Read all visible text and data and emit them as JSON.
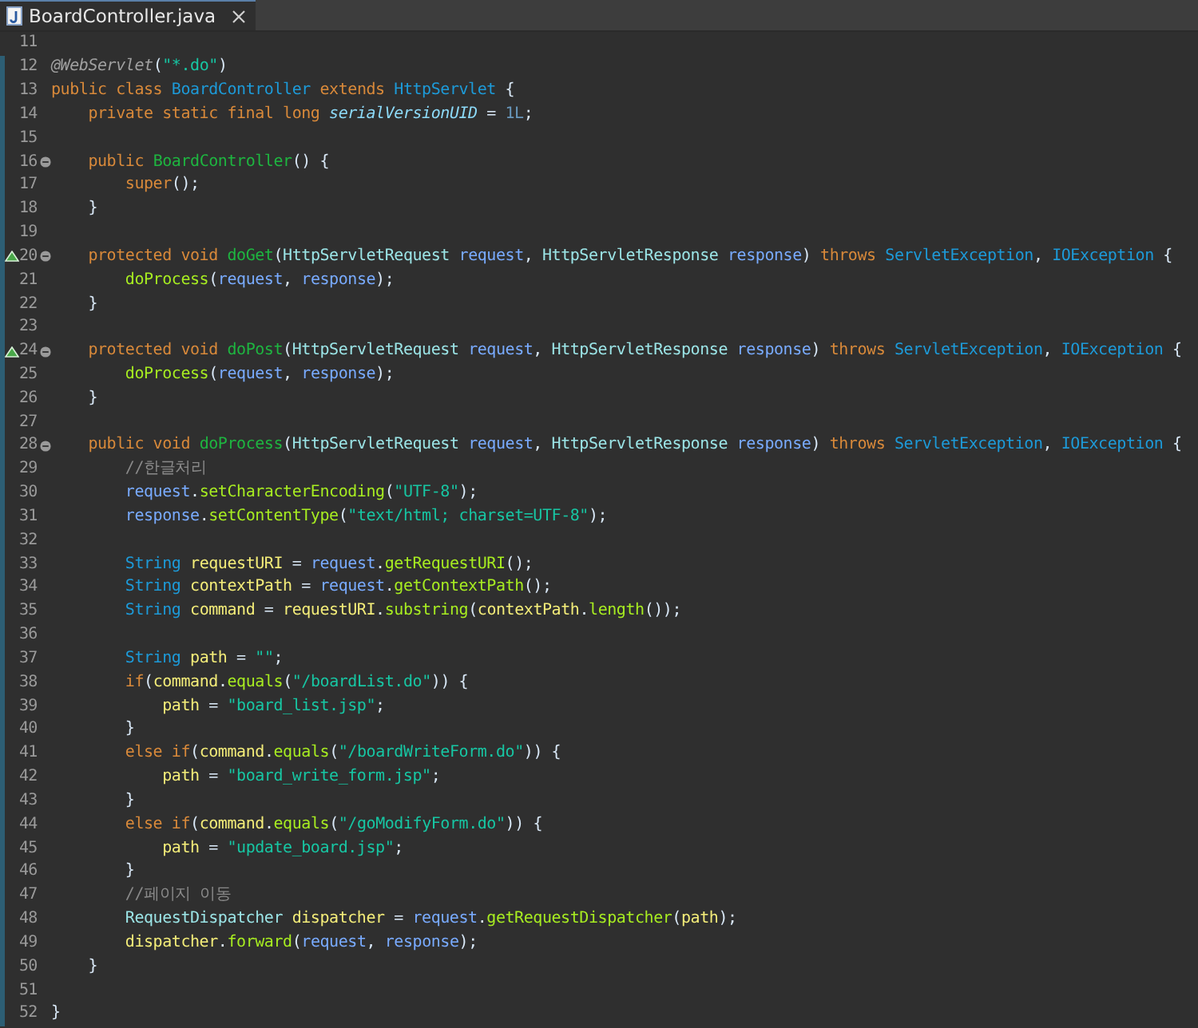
{
  "tabs": [
    {
      "label": "BoardController.java",
      "selected": true
    }
  ],
  "editor": {
    "lines": [
      {
        "number": "11",
        "changed": false,
        "fold": false,
        "override": false
      },
      {
        "number": "12",
        "changed": true,
        "fold": false,
        "override": false,
        "tokens": [
          {
            "kind": "ann",
            "text": "@WebServlet"
          },
          {
            "kind": "plain",
            "text": "("
          },
          {
            "kind": "str",
            "text": "\"*.do\""
          },
          {
            "kind": "plain",
            "text": ")"
          }
        ]
      },
      {
        "number": "13",
        "changed": true,
        "fold": false,
        "override": false,
        "tokens": [
          {
            "kind": "kw",
            "text": "public class "
          },
          {
            "kind": "cls",
            "text": "BoardController"
          },
          {
            "kind": "kw",
            "text": " extends "
          },
          {
            "kind": "cls",
            "text": "HttpServlet"
          },
          {
            "kind": "plain",
            "text": " {"
          }
        ]
      },
      {
        "number": "14",
        "changed": true,
        "fold": false,
        "override": false,
        "tokens": [
          {
            "kind": "kw",
            "text": "    private static final long "
          },
          {
            "kind": "field",
            "text": "serialVersionUID"
          },
          {
            "kind": "plain",
            "text": " = "
          },
          {
            "kind": "num",
            "text": "1L"
          },
          {
            "kind": "plain",
            "text": ";"
          }
        ]
      },
      {
        "number": "15",
        "changed": true,
        "fold": false,
        "override": false
      },
      {
        "number": "16",
        "changed": true,
        "fold": true,
        "override": false,
        "tokens": [
          {
            "kind": "kw",
            "text": "    public "
          },
          {
            "kind": "decl",
            "text": "BoardController"
          },
          {
            "kind": "plain",
            "text": "() {"
          }
        ]
      },
      {
        "number": "17",
        "changed": true,
        "fold": false,
        "override": false,
        "tokens": [
          {
            "kind": "kw",
            "text": "        super"
          },
          {
            "kind": "plain",
            "text": "();"
          }
        ]
      },
      {
        "number": "18",
        "changed": true,
        "fold": false,
        "override": false,
        "tokens": [
          {
            "kind": "plain",
            "text": "    }"
          }
        ]
      },
      {
        "number": "19",
        "changed": true,
        "fold": false,
        "override": false
      },
      {
        "number": "20",
        "changed": true,
        "fold": true,
        "override": true,
        "tokens": [
          {
            "kind": "kw",
            "text": "    protected void "
          },
          {
            "kind": "decl",
            "text": "doGet"
          },
          {
            "kind": "plain",
            "text": "("
          },
          {
            "kind": "typ",
            "text": "HttpServletRequest"
          },
          {
            "kind": "param",
            "text": " request"
          },
          {
            "kind": "plain",
            "text": ", "
          },
          {
            "kind": "typ",
            "text": "HttpServletResponse"
          },
          {
            "kind": "param",
            "text": " response"
          },
          {
            "kind": "plain",
            "text": ") "
          },
          {
            "kind": "kw",
            "text": "throws "
          },
          {
            "kind": "cls",
            "text": "ServletException"
          },
          {
            "kind": "plain",
            "text": ", "
          },
          {
            "kind": "cls",
            "text": "IOException"
          },
          {
            "kind": "plain",
            "text": " {"
          }
        ]
      },
      {
        "number": "21",
        "changed": true,
        "fold": false,
        "override": false,
        "tokens": [
          {
            "kind": "call",
            "text": "        doProcess"
          },
          {
            "kind": "plain",
            "text": "("
          },
          {
            "kind": "param",
            "text": "request"
          },
          {
            "kind": "plain",
            "text": ", "
          },
          {
            "kind": "param",
            "text": "response"
          },
          {
            "kind": "plain",
            "text": ");"
          }
        ]
      },
      {
        "number": "22",
        "changed": true,
        "fold": false,
        "override": false,
        "tokens": [
          {
            "kind": "plain",
            "text": "    }"
          }
        ]
      },
      {
        "number": "23",
        "changed": true,
        "fold": false,
        "override": false
      },
      {
        "number": "24",
        "changed": true,
        "fold": true,
        "override": true,
        "tokens": [
          {
            "kind": "kw",
            "text": "    protected void "
          },
          {
            "kind": "decl",
            "text": "doPost"
          },
          {
            "kind": "plain",
            "text": "("
          },
          {
            "kind": "typ",
            "text": "HttpServletRequest"
          },
          {
            "kind": "param",
            "text": " request"
          },
          {
            "kind": "plain",
            "text": ", "
          },
          {
            "kind": "typ",
            "text": "HttpServletResponse"
          },
          {
            "kind": "param",
            "text": " response"
          },
          {
            "kind": "plain",
            "text": ") "
          },
          {
            "kind": "kw",
            "text": "throws "
          },
          {
            "kind": "cls",
            "text": "ServletException"
          },
          {
            "kind": "plain",
            "text": ", "
          },
          {
            "kind": "cls",
            "text": "IOException"
          },
          {
            "kind": "plain",
            "text": " {"
          }
        ]
      },
      {
        "number": "25",
        "changed": true,
        "fold": false,
        "override": false,
        "tokens": [
          {
            "kind": "call",
            "text": "        doProcess"
          },
          {
            "kind": "plain",
            "text": "("
          },
          {
            "kind": "param",
            "text": "request"
          },
          {
            "kind": "plain",
            "text": ", "
          },
          {
            "kind": "param",
            "text": "response"
          },
          {
            "kind": "plain",
            "text": ");"
          }
        ]
      },
      {
        "number": "26",
        "changed": true,
        "fold": false,
        "override": false,
        "tokens": [
          {
            "kind": "plain",
            "text": "    }"
          }
        ]
      },
      {
        "number": "27",
        "changed": true,
        "fold": false,
        "override": false
      },
      {
        "number": "28",
        "changed": true,
        "fold": true,
        "override": false,
        "tokens": [
          {
            "kind": "kw",
            "text": "    public void "
          },
          {
            "kind": "decl",
            "text": "doProcess"
          },
          {
            "kind": "plain",
            "text": "("
          },
          {
            "kind": "typ",
            "text": "HttpServletRequest"
          },
          {
            "kind": "param",
            "text": " request"
          },
          {
            "kind": "plain",
            "text": ", "
          },
          {
            "kind": "typ",
            "text": "HttpServletResponse"
          },
          {
            "kind": "param",
            "text": " response"
          },
          {
            "kind": "plain",
            "text": ") "
          },
          {
            "kind": "kw",
            "text": "throws "
          },
          {
            "kind": "cls",
            "text": "ServletException"
          },
          {
            "kind": "plain",
            "text": ", "
          },
          {
            "kind": "cls",
            "text": "IOException"
          },
          {
            "kind": "plain",
            "text": " {"
          }
        ]
      },
      {
        "number": "29",
        "changed": true,
        "fold": false,
        "override": false,
        "tokens": [
          {
            "kind": "cmt",
            "text": "        //한글처리"
          }
        ]
      },
      {
        "number": "30",
        "changed": true,
        "fold": false,
        "override": false,
        "tokens": [
          {
            "kind": "param",
            "text": "        request"
          },
          {
            "kind": "plain",
            "text": "."
          },
          {
            "kind": "call",
            "text": "setCharacterEncoding"
          },
          {
            "kind": "plain",
            "text": "("
          },
          {
            "kind": "str",
            "text": "\"UTF-8\""
          },
          {
            "kind": "plain",
            "text": ");"
          }
        ]
      },
      {
        "number": "31",
        "changed": true,
        "fold": false,
        "override": false,
        "tokens": [
          {
            "kind": "param",
            "text": "        response"
          },
          {
            "kind": "plain",
            "text": "."
          },
          {
            "kind": "call",
            "text": "setContentType"
          },
          {
            "kind": "plain",
            "text": "("
          },
          {
            "kind": "str",
            "text": "\"text/html; charset=UTF-8\""
          },
          {
            "kind": "plain",
            "text": ");"
          }
        ]
      },
      {
        "number": "32",
        "changed": true,
        "fold": false,
        "override": false
      },
      {
        "number": "33",
        "changed": true,
        "fold": false,
        "override": false,
        "tokens": [
          {
            "kind": "cls",
            "text": "        String"
          },
          {
            "kind": "local",
            "text": " requestURI"
          },
          {
            "kind": "plain",
            "text": " = "
          },
          {
            "kind": "param",
            "text": "request"
          },
          {
            "kind": "plain",
            "text": "."
          },
          {
            "kind": "call",
            "text": "getRequestURI"
          },
          {
            "kind": "plain",
            "text": "();"
          }
        ]
      },
      {
        "number": "34",
        "changed": true,
        "fold": false,
        "override": false,
        "tokens": [
          {
            "kind": "cls",
            "text": "        String"
          },
          {
            "kind": "local",
            "text": " contextPath"
          },
          {
            "kind": "plain",
            "text": " = "
          },
          {
            "kind": "param",
            "text": "request"
          },
          {
            "kind": "plain",
            "text": "."
          },
          {
            "kind": "call",
            "text": "getContextPath"
          },
          {
            "kind": "plain",
            "text": "();"
          }
        ]
      },
      {
        "number": "35",
        "changed": true,
        "fold": false,
        "override": false,
        "tokens": [
          {
            "kind": "cls",
            "text": "        String"
          },
          {
            "kind": "local",
            "text": " command"
          },
          {
            "kind": "plain",
            "text": " = "
          },
          {
            "kind": "local",
            "text": "requestURI"
          },
          {
            "kind": "plain",
            "text": "."
          },
          {
            "kind": "call",
            "text": "substring"
          },
          {
            "kind": "plain",
            "text": "("
          },
          {
            "kind": "local",
            "text": "contextPath"
          },
          {
            "kind": "plain",
            "text": "."
          },
          {
            "kind": "call",
            "text": "length"
          },
          {
            "kind": "plain",
            "text": "());"
          }
        ]
      },
      {
        "number": "36",
        "changed": true,
        "fold": false,
        "override": false
      },
      {
        "number": "37",
        "changed": true,
        "fold": false,
        "override": false,
        "tokens": [
          {
            "kind": "cls",
            "text": "        String"
          },
          {
            "kind": "local",
            "text": " path"
          },
          {
            "kind": "plain",
            "text": " = "
          },
          {
            "kind": "str",
            "text": "\"\""
          },
          {
            "kind": "plain",
            "text": ";"
          }
        ]
      },
      {
        "number": "38",
        "changed": true,
        "fold": false,
        "override": false,
        "tokens": [
          {
            "kind": "kw",
            "text": "        if"
          },
          {
            "kind": "plain",
            "text": "("
          },
          {
            "kind": "local",
            "text": "command"
          },
          {
            "kind": "plain",
            "text": "."
          },
          {
            "kind": "call",
            "text": "equals"
          },
          {
            "kind": "plain",
            "text": "("
          },
          {
            "kind": "str",
            "text": "\"/boardList.do\""
          },
          {
            "kind": "plain",
            "text": ")) {"
          }
        ]
      },
      {
        "number": "39",
        "changed": true,
        "fold": false,
        "override": false,
        "tokens": [
          {
            "kind": "local",
            "text": "            path"
          },
          {
            "kind": "plain",
            "text": " = "
          },
          {
            "kind": "str",
            "text": "\"board_list.jsp\""
          },
          {
            "kind": "plain",
            "text": ";"
          }
        ]
      },
      {
        "number": "40",
        "changed": true,
        "fold": false,
        "override": false,
        "tokens": [
          {
            "kind": "plain",
            "text": "        }"
          }
        ]
      },
      {
        "number": "41",
        "changed": true,
        "fold": false,
        "override": false,
        "tokens": [
          {
            "kind": "kw",
            "text": "        else if"
          },
          {
            "kind": "plain",
            "text": "("
          },
          {
            "kind": "local",
            "text": "command"
          },
          {
            "kind": "plain",
            "text": "."
          },
          {
            "kind": "call",
            "text": "equals"
          },
          {
            "kind": "plain",
            "text": "("
          },
          {
            "kind": "str",
            "text": "\"/boardWriteForm.do\""
          },
          {
            "kind": "plain",
            "text": ")) {"
          }
        ]
      },
      {
        "number": "42",
        "changed": true,
        "fold": false,
        "override": false,
        "tokens": [
          {
            "kind": "local",
            "text": "            path"
          },
          {
            "kind": "plain",
            "text": " = "
          },
          {
            "kind": "str",
            "text": "\"board_write_form.jsp\""
          },
          {
            "kind": "plain",
            "text": ";"
          }
        ]
      },
      {
        "number": "43",
        "changed": true,
        "fold": false,
        "override": false,
        "tokens": [
          {
            "kind": "plain",
            "text": "        }"
          }
        ]
      },
      {
        "number": "44",
        "changed": true,
        "fold": false,
        "override": false,
        "tokens": [
          {
            "kind": "kw",
            "text": "        else if"
          },
          {
            "kind": "plain",
            "text": "("
          },
          {
            "kind": "local",
            "text": "command"
          },
          {
            "kind": "plain",
            "text": "."
          },
          {
            "kind": "call",
            "text": "equals"
          },
          {
            "kind": "plain",
            "text": "("
          },
          {
            "kind": "str",
            "text": "\"/goModifyForm.do\""
          },
          {
            "kind": "plain",
            "text": ")) {"
          }
        ]
      },
      {
        "number": "45",
        "changed": true,
        "fold": false,
        "override": false,
        "tokens": [
          {
            "kind": "local",
            "text": "            path"
          },
          {
            "kind": "plain",
            "text": " = "
          },
          {
            "kind": "str",
            "text": "\"update_board.jsp\""
          },
          {
            "kind": "plain",
            "text": ";"
          }
        ]
      },
      {
        "number": "46",
        "changed": true,
        "fold": false,
        "override": false,
        "tokens": [
          {
            "kind": "plain",
            "text": "        }"
          }
        ]
      },
      {
        "number": "47",
        "changed": true,
        "fold": false,
        "override": false,
        "tokens": [
          {
            "kind": "cmt",
            "text": "        //페이지 이동"
          }
        ]
      },
      {
        "number": "48",
        "changed": true,
        "fold": false,
        "override": false,
        "tokens": [
          {
            "kind": "typ",
            "text": "        RequestDispatcher"
          },
          {
            "kind": "local",
            "text": " dispatcher"
          },
          {
            "kind": "plain",
            "text": " = "
          },
          {
            "kind": "param",
            "text": "request"
          },
          {
            "kind": "plain",
            "text": "."
          },
          {
            "kind": "call",
            "text": "getRequestDispatcher"
          },
          {
            "kind": "plain",
            "text": "("
          },
          {
            "kind": "local",
            "text": "path"
          },
          {
            "kind": "plain",
            "text": ");"
          }
        ]
      },
      {
        "number": "49",
        "changed": true,
        "fold": false,
        "override": false,
        "tokens": [
          {
            "kind": "local",
            "text": "        dispatcher"
          },
          {
            "kind": "plain",
            "text": "."
          },
          {
            "kind": "call",
            "text": "forward"
          },
          {
            "kind": "plain",
            "text": "("
          },
          {
            "kind": "param",
            "text": "request"
          },
          {
            "kind": "plain",
            "text": ", "
          },
          {
            "kind": "param",
            "text": "response"
          },
          {
            "kind": "plain",
            "text": ");"
          }
        ]
      },
      {
        "number": "50",
        "changed": true,
        "fold": false,
        "override": false,
        "tokens": [
          {
            "kind": "plain",
            "text": "    }"
          }
        ]
      },
      {
        "number": "51",
        "changed": true,
        "fold": false,
        "override": false
      },
      {
        "number": "52",
        "changed": true,
        "fold": false,
        "override": false,
        "tokens": [
          {
            "kind": "plain",
            "text": "}"
          }
        ]
      }
    ]
  }
}
